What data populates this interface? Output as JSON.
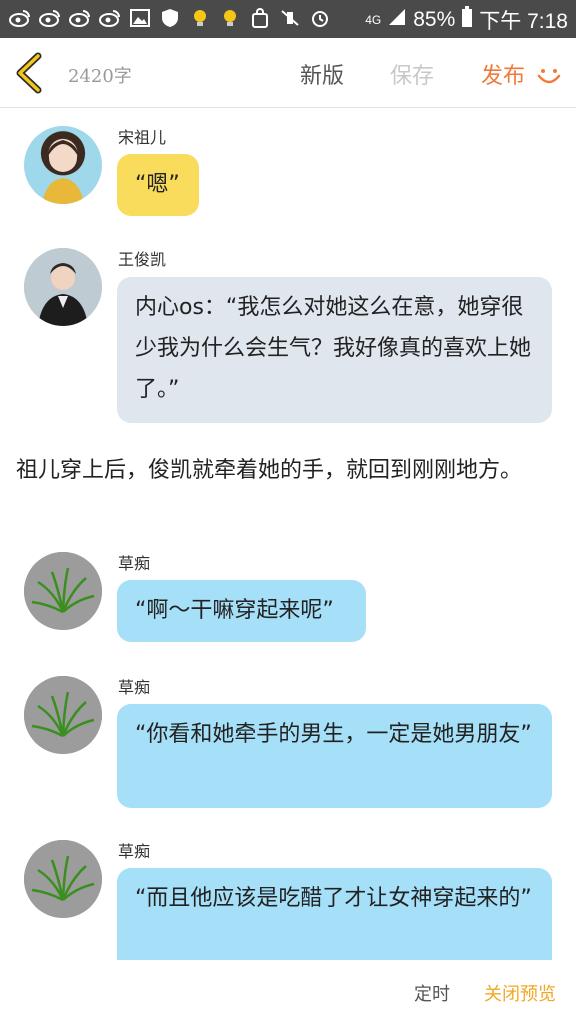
{
  "status_bar": {
    "battery": "85%",
    "time": "下午 7:18",
    "network": "4G",
    "icons": [
      "weibo-icon",
      "weibo-icon",
      "weibo-icon",
      "weibo-icon",
      "image-icon",
      "shield-icon",
      "bulb-icon",
      "bulb-icon",
      "bag-icon",
      "mute-icon",
      "alarm-icon",
      "signal-icon",
      "battery-icon"
    ]
  },
  "toolbar": {
    "word_count": "2420字",
    "new_label": "新版",
    "save_label": "保存",
    "publish_label": "发布",
    "publish_color": "#f07a3a"
  },
  "messages": [
    {
      "sender": "宋祖儿",
      "text": "“嗯”",
      "style": "yellow"
    },
    {
      "sender": "王俊凯",
      "text": "内心os：“我怎么对她这么在意，她穿很少我为什么会生气？我好像真的喜欢上她了。”",
      "style": "gray"
    },
    {
      "narration": "祖儿穿上后，俊凯就牵着她的手，就回到刚刚地方。"
    },
    {
      "sender": "草痴",
      "text": "“啊～干嘛穿起来呢”",
      "style": "blue"
    },
    {
      "sender": "草痴",
      "text": "“你看和她牵手的男生，一定是她男朋友”",
      "style": "blue"
    },
    {
      "sender": "草痴",
      "text": "“而且他应该是吃醋了才让女神穿起来的”",
      "style": "blue"
    }
  ],
  "bottom_bar": {
    "schedule_label": "定时",
    "close_preview_label": "关闭预览"
  },
  "colors": {
    "yellow_bubble": "#f9dc5c",
    "gray_bubble": "#dfe6ee",
    "blue_bubble": "#a6dff8",
    "accent_orange": "#f07a3a",
    "accent_yellow": "#f2a825"
  }
}
